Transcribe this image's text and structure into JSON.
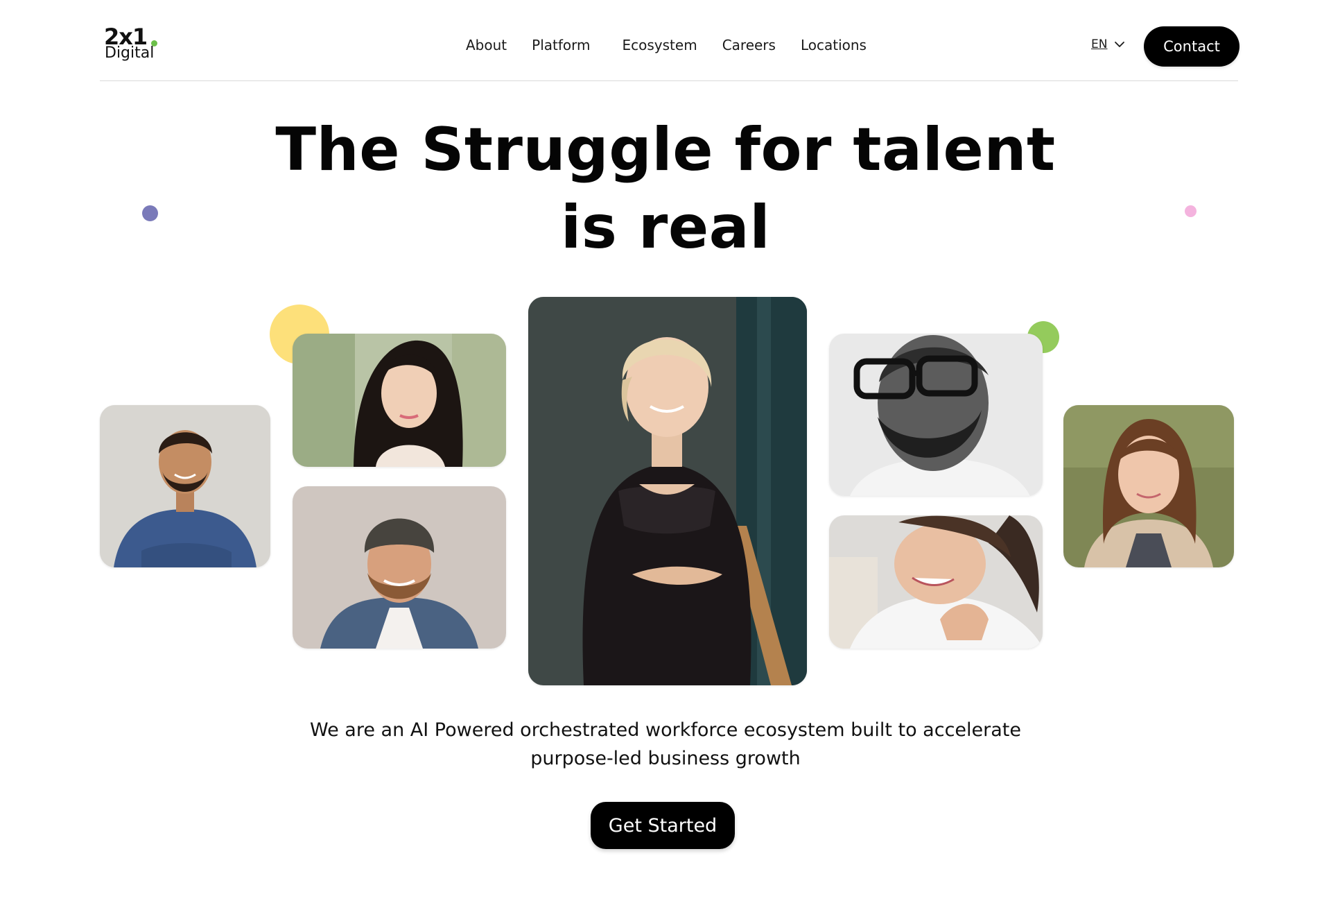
{
  "header": {
    "logo": {
      "main": "2x1",
      "sub": "Digital",
      "accent_color": "#6cc04a"
    },
    "nav": [
      {
        "label": "About"
      },
      {
        "label": "Platform"
      },
      {
        "label": "Ecosystem"
      },
      {
        "label": "Careers"
      },
      {
        "label": "Locations"
      }
    ],
    "language": {
      "selected": "EN",
      "icon": "chevron-down-icon"
    },
    "contact_label": "Contact"
  },
  "hero": {
    "title_line_1": "The Struggle for talent",
    "title_line_2": "is real"
  },
  "decor_colors": {
    "purple": "#7a7ab9",
    "pink": "#f4b3de",
    "yellow": "#fde07a",
    "green": "#94cb5c"
  },
  "intro": {
    "line_1": "We are an AI Powered orchestrated workforce ecosystem built to accelerate",
    "line_2": "purpose-led business growth"
  },
  "cta": {
    "label": "Get Started",
    "color": "#000000"
  }
}
